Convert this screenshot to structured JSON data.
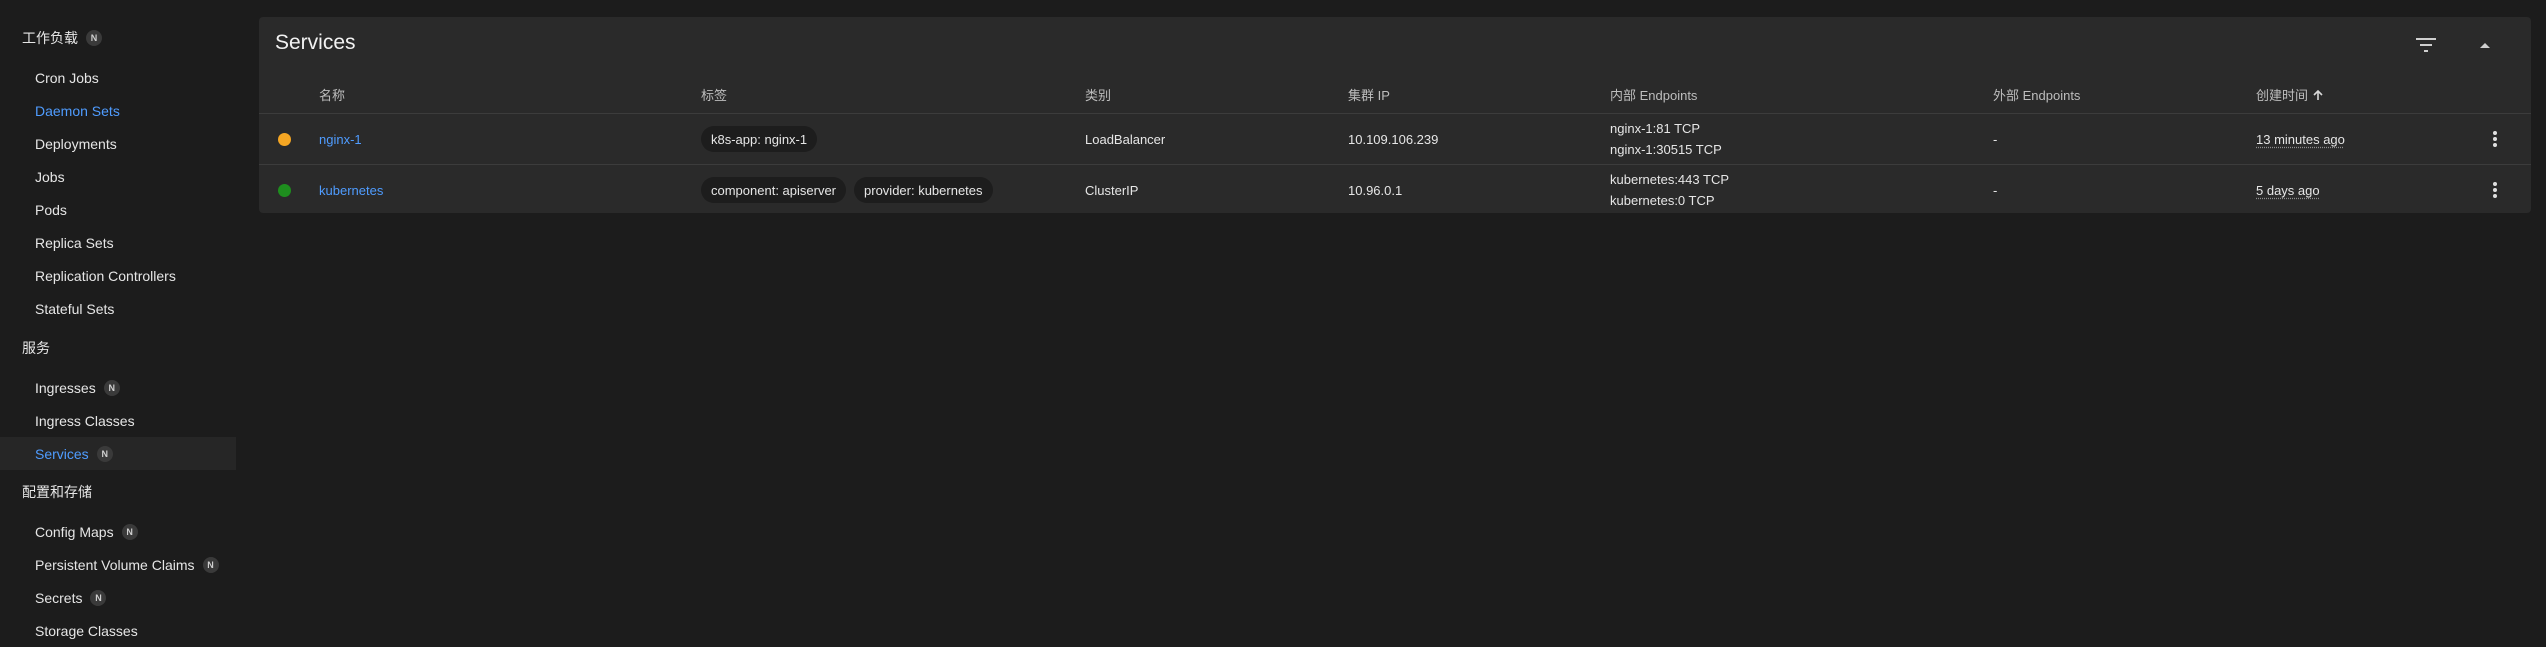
{
  "sidebar": {
    "sections": [
      {
        "title": "工作负载",
        "badge": "N",
        "items": [
          {
            "label": "Cron Jobs"
          },
          {
            "label": "Daemon Sets"
          },
          {
            "label": "Deployments"
          },
          {
            "label": "Jobs"
          },
          {
            "label": "Pods"
          },
          {
            "label": "Replica Sets"
          },
          {
            "label": "Replication Controllers"
          },
          {
            "label": "Stateful Sets"
          }
        ]
      },
      {
        "title": "服务",
        "items": [
          {
            "label": "Ingresses",
            "badge": "N"
          },
          {
            "label": "Ingress Classes"
          },
          {
            "label": "Services",
            "badge": "N"
          }
        ]
      },
      {
        "title": "配置和存储",
        "items": [
          {
            "label": "Config Maps",
            "badge": "N"
          },
          {
            "label": "Persistent Volume Claims",
            "badge": "N"
          },
          {
            "label": "Secrets",
            "badge": "N"
          },
          {
            "label": "Storage Classes"
          }
        ]
      }
    ]
  },
  "card": {
    "title": "Services",
    "filter_icon": "filter-icon",
    "collapse_icon": "caret-up-icon"
  },
  "table": {
    "columns": {
      "name": "名称",
      "labels": "标签",
      "type": "类别",
      "cluster_ip": "集群 IP",
      "internal_endpoints": "内部 Endpoints",
      "external_endpoints": "外部 Endpoints",
      "created": "创建时间",
      "sort_icon": "arrow-up-icon"
    },
    "rows": [
      {
        "status_color": "#f5a623",
        "name": "nginx-1",
        "labels": [
          "k8s-app: nginx-1"
        ],
        "type": "LoadBalancer",
        "cluster_ip": "10.109.106.239",
        "internal_endpoints": [
          "nginx-1:81 TCP",
          "nginx-1:30515 TCP"
        ],
        "external_endpoints": "-",
        "created": "13 minutes ago"
      },
      {
        "status_color": "#1e8e1e",
        "name": "kubernetes",
        "labels": [
          "component: apiserver",
          "provider: kubernetes"
        ],
        "type": "ClusterIP",
        "cluster_ip": "10.96.0.1",
        "internal_endpoints": [
          "kubernetes:443 TCP",
          "kubernetes:0 TCP"
        ],
        "external_endpoints": "-",
        "created": "5 days ago"
      }
    ]
  },
  "colors": {
    "accent": "#4f9cff",
    "background": "#1c1c1c",
    "card": "#2a2a2a"
  }
}
